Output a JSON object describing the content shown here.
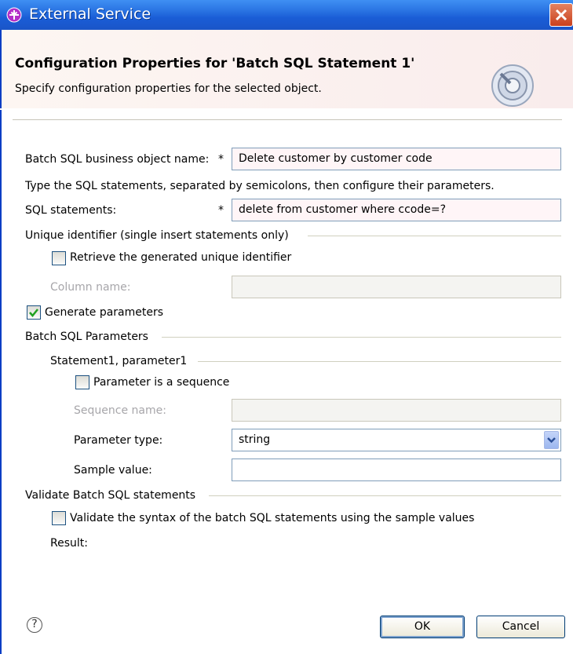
{
  "window": {
    "title": "External Service"
  },
  "banner": {
    "title": "Configuration Properties for 'Batch SQL Statement 1'",
    "description": "Specify configuration properties for the selected object."
  },
  "form": {
    "bo_name_label": "Batch SQL business object name:",
    "required_mark": "*",
    "bo_name_value": "Delete customer by customer code",
    "instructions": "Type the SQL statements, separated by semicolons, then configure their parameters.",
    "sql_label": "SQL statements:",
    "sql_value": "delete from customer where ccode=?",
    "unique_group_label": "Unique identifier (single insert statements only)",
    "retrieve_label": "Retrieve the generated unique identifier",
    "retrieve_checked": false,
    "column_name_label": "Column name:",
    "column_name_value": "",
    "generate_label": "Generate parameters",
    "generate_checked": true,
    "batch_params_label": "Batch SQL Parameters",
    "statement_group_label": "Statement1, parameter1",
    "sequence_check_label": "Parameter is a sequence",
    "sequence_checked": false,
    "sequence_name_label": "Sequence name:",
    "sequence_name_value": "",
    "param_type_label": "Parameter type:",
    "param_type_value": "string",
    "sample_label": "Sample value:",
    "sample_value": "",
    "validate_group_label": "Validate Batch SQL statements",
    "validate_check_label": "Validate the syntax of the batch SQL statements using the sample values",
    "validate_checked": false,
    "result_label": "Result:"
  },
  "buttons": {
    "ok": "OK",
    "cancel": "Cancel",
    "help": "?"
  },
  "colors": {
    "title_bar": "#2a74e3",
    "close_button": "#c9401c",
    "banner_bg": "#f9ecec",
    "field_border": "#7f9db9"
  },
  "icons": {
    "title": "external-service-icon",
    "banner": "wizard-gear-icon",
    "close": "close-icon",
    "help": "help-icon",
    "dropdown": "chevron-down-icon"
  }
}
